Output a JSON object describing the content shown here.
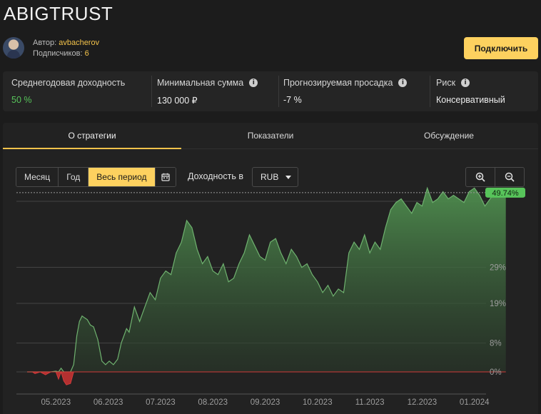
{
  "header": {
    "title": "ABIGTRUST"
  },
  "author": {
    "label": "Автор:",
    "name": "avbacherov",
    "subscribers_label": "Подписчиков:",
    "subscribers": "6"
  },
  "actions": {
    "connect": "Подключить"
  },
  "stats": [
    {
      "label": "Среднегодовая доходность",
      "value": "50 %",
      "info": false
    },
    {
      "label": "Минимальная сумма",
      "value": "130 000 ₽",
      "info": true
    },
    {
      "label": "Прогнозируемая просадка",
      "value": "-7 %",
      "info": true
    },
    {
      "label": "Риск",
      "value": "Консервативный",
      "info": true
    }
  ],
  "tabs": [
    "О стратегии",
    "Показатели",
    "Обсуждение"
  ],
  "active_tab": 0,
  "periods": [
    "Месяц",
    "Год",
    "Весь период"
  ],
  "active_period": 2,
  "yield_label": "Доходность в",
  "currency": "RUB",
  "icons": {
    "calendar": "calendar-icon",
    "zoom_in": "zoom-in-icon",
    "zoom_out": "zoom-out-icon",
    "info": "info-icon",
    "caret": "chevron-down-icon"
  },
  "colors": {
    "accent": "#fdd15f",
    "positive": "#57c45a",
    "negative": "#d23b3b",
    "area_top": "#4c8a4c"
  },
  "chart_data": {
    "type": "area",
    "x_unit": "months since 2023-05-01",
    "xtick_labels": [
      "05.2023",
      "06.2023",
      "07.2023",
      "08.2023",
      "09.2023",
      "10.2023",
      "11.2023",
      "12.2023",
      "01.2024"
    ],
    "ytick_labels": [
      "0%",
      "8%",
      "19%",
      "29%"
    ],
    "ytick_values": [
      0,
      8,
      19,
      29
    ],
    "ylim": [
      -4,
      52
    ],
    "last_value_label": "49.74%",
    "last_value": 49.74,
    "grid": true,
    "series": [
      {
        "x": [
          -0.55,
          -0.45,
          -0.4,
          -0.3,
          -0.2,
          -0.1,
          0.0,
          0.05,
          0.1,
          0.15,
          0.2,
          0.28,
          0.34,
          0.4,
          0.45,
          0.5,
          0.55,
          0.6,
          0.66,
          0.72,
          0.8,
          0.88,
          0.95,
          1.02,
          1.1,
          1.18,
          1.25,
          1.3,
          1.35,
          1.4,
          1.5,
          1.6,
          1.7,
          1.8,
          1.9,
          2.0,
          2.1,
          2.2,
          2.3,
          2.4,
          2.5,
          2.6,
          2.7,
          2.8,
          2.9,
          3.0,
          3.1,
          3.2,
          3.3,
          3.4,
          3.5,
          3.6,
          3.7,
          3.8,
          3.9,
          4.0,
          4.1,
          4.2,
          4.3,
          4.4,
          4.5,
          4.6,
          4.7,
          4.8,
          4.9,
          5.0,
          5.1,
          5.2,
          5.3,
          5.4,
          5.5,
          5.6,
          5.7,
          5.8,
          5.9,
          6.0,
          6.1,
          6.2,
          6.3,
          6.4,
          6.5,
          6.6,
          6.7,
          6.8,
          6.9,
          7.0,
          7.1,
          7.2,
          7.3,
          7.4,
          7.5,
          7.6,
          7.7,
          7.8,
          7.9,
          8.0,
          8.1,
          8.2,
          8.3,
          8.4,
          8.5,
          8.6
        ],
        "y": [
          0,
          0,
          -0.5,
          0,
          -0.8,
          0,
          0.2,
          -2.0,
          1.0,
          -2.5,
          -3.6,
          -3.2,
          2.0,
          10.0,
          14.0,
          15.5,
          15.0,
          14.5,
          13.0,
          12.5,
          9.0,
          3.0,
          2.0,
          3.0,
          2.0,
          3.5,
          8.0,
          10.0,
          12.0,
          11.0,
          18.0,
          14.0,
          18.0,
          22.0,
          20.0,
          26.0,
          28.0,
          27.0,
          33.0,
          36.0,
          42.0,
          40.0,
          34.0,
          30.0,
          32.0,
          28.0,
          27.0,
          30.0,
          25.0,
          26.0,
          30.0,
          33.0,
          38.0,
          35.0,
          32.0,
          31.0,
          36.0,
          37.0,
          33.0,
          30.0,
          34.0,
          32.0,
          29.0,
          30.0,
          27.0,
          25.0,
          22.0,
          24.0,
          21.0,
          23.0,
          22.0,
          33.0,
          36.0,
          34.0,
          38.0,
          33.0,
          36.0,
          34.0,
          40.0,
          45.0,
          47.0,
          48.0,
          46.0,
          44.0,
          47.0,
          46.0,
          51.0,
          47.0,
          48.0,
          50.0,
          48.0,
          49.0,
          48.0,
          47.0,
          50.0,
          51.0,
          49.0,
          46.0,
          48.0,
          50.0,
          49.74,
          49.74
        ]
      }
    ]
  }
}
